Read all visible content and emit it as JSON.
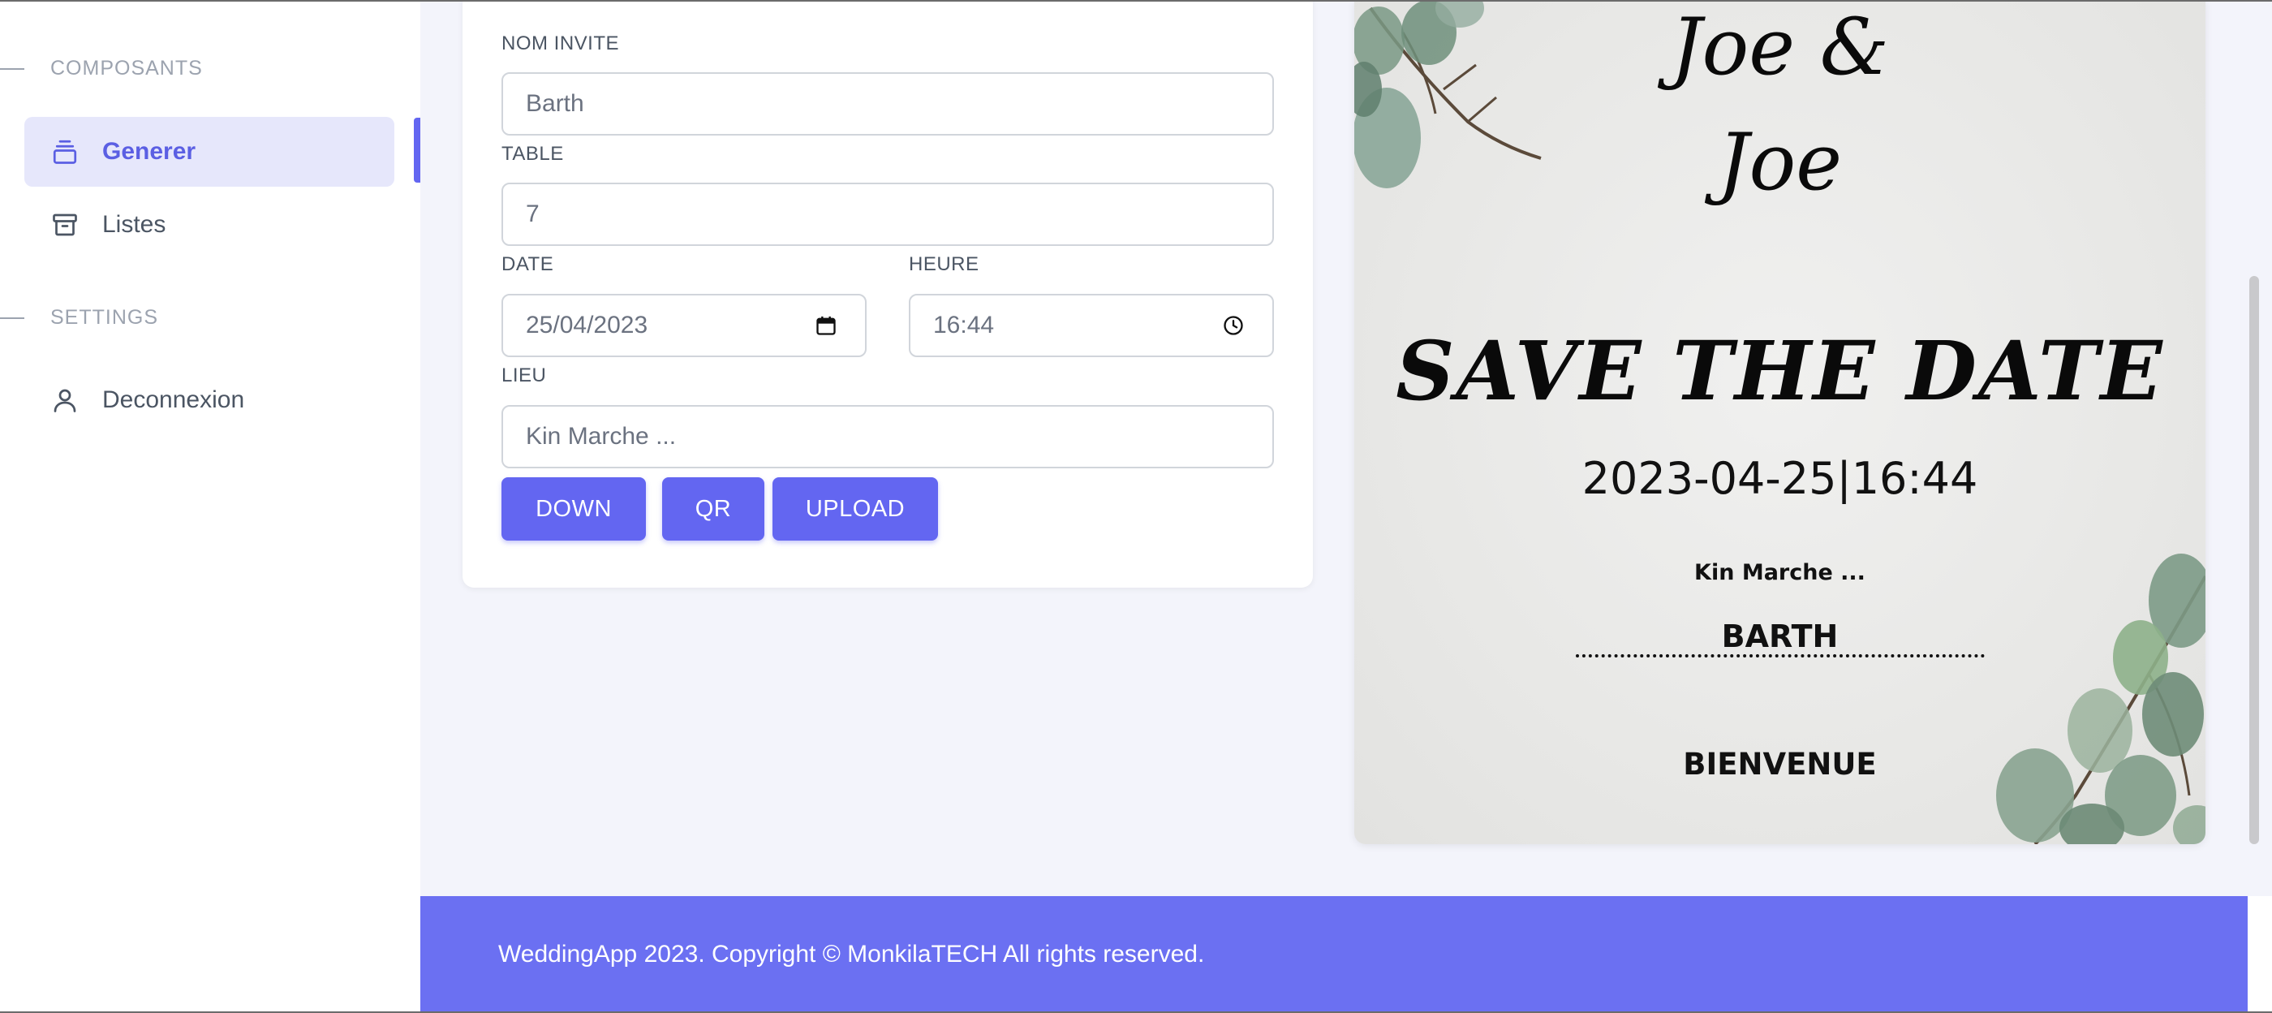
{
  "sidebar": {
    "sections": [
      {
        "title": "COMPOSANTS"
      },
      {
        "title": "SETTINGS"
      }
    ],
    "items": [
      {
        "label": "Generer",
        "icon": "layers-icon",
        "active": true
      },
      {
        "label": "Listes",
        "icon": "archive-icon"
      },
      {
        "label": "Deconnexion",
        "icon": "user-icon"
      }
    ]
  },
  "form": {
    "guest_name": {
      "label": "NOM INVITE",
      "value": "Barth"
    },
    "table": {
      "label": "TABLE",
      "value": "7"
    },
    "date": {
      "label": "DATE",
      "value": "25/04/2023"
    },
    "time": {
      "label": "HEURE",
      "value": "16:44"
    },
    "place": {
      "label": "LIEU",
      "value": "Kin Marche ..."
    },
    "buttons": {
      "down": "DOWN",
      "qr": "QR",
      "upload": "UPLOAD"
    }
  },
  "invitation": {
    "couple_line1": "Joe &",
    "couple_line2": "Joe",
    "headline": "SAVE THE DATE",
    "date_time": "2023-04-25|16:44",
    "place": "Kin Marche ...",
    "guest": "BARTH",
    "welcome": "BIENVENUE"
  },
  "footer": {
    "text": "WeddingApp 2023. Copyright © MonkilaTECH All rights reserved."
  },
  "colors": {
    "accent": "#6366f1",
    "footer": "#6b70f2",
    "active_bg": "#e6e7fb",
    "page_bg": "#f3f4fb"
  }
}
